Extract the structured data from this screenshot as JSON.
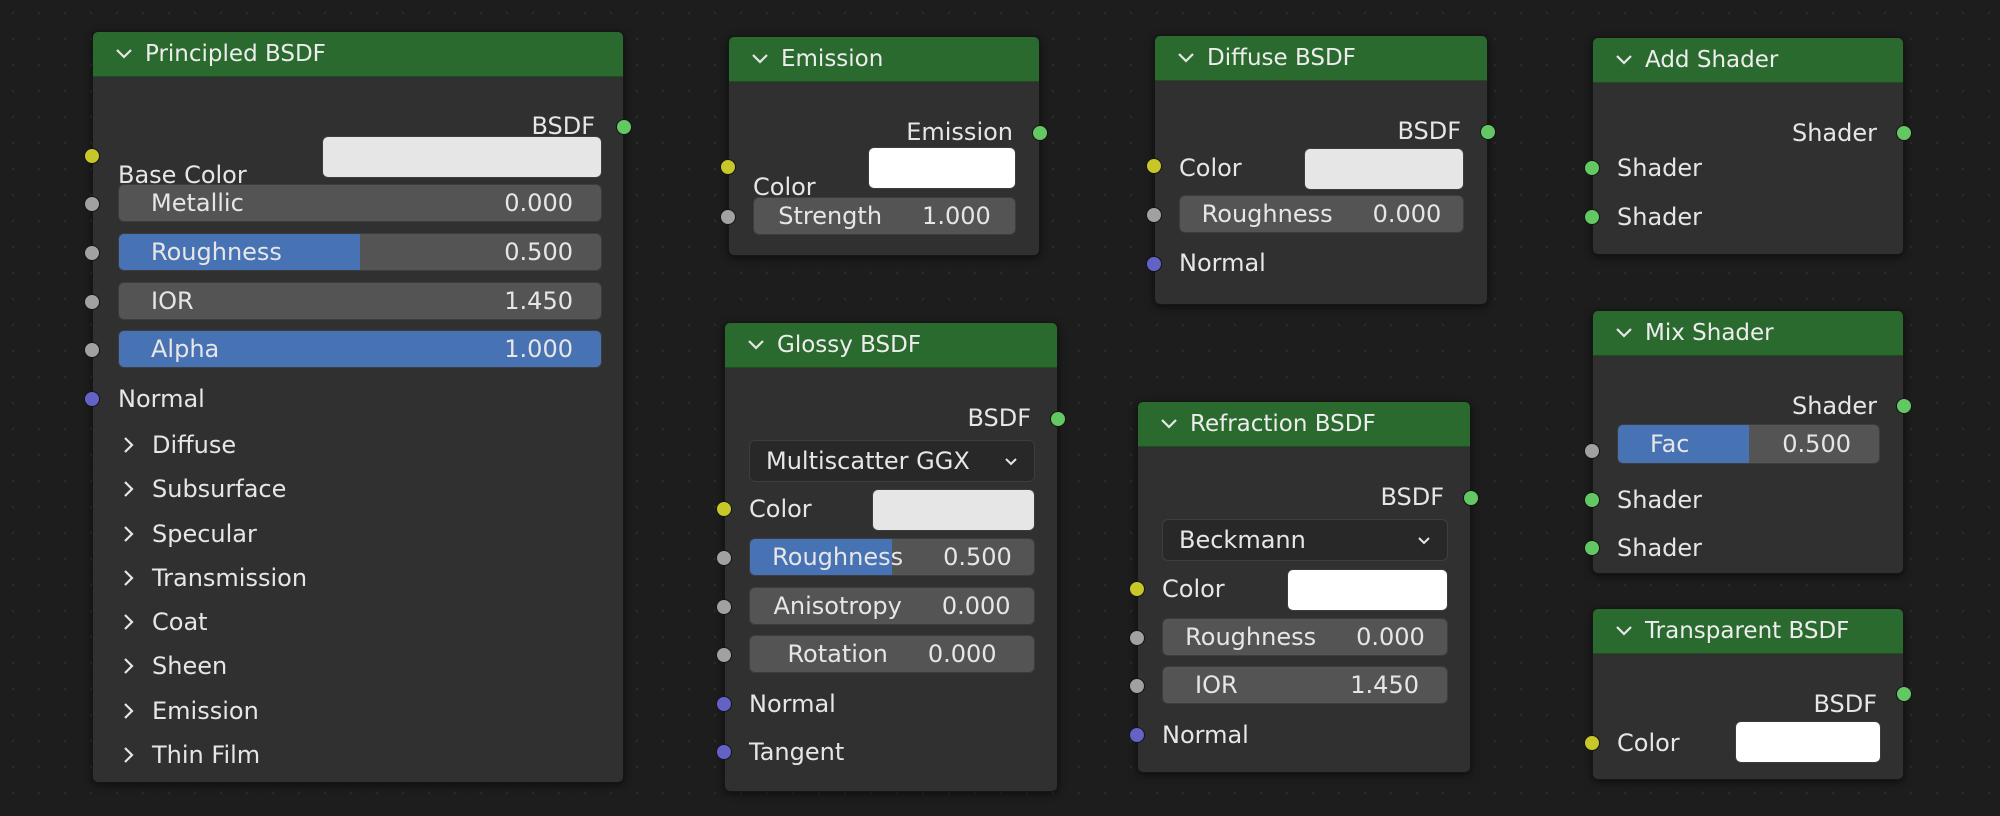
{
  "colors": {
    "header": "#2b6a2e",
    "socket_shader": "#63c763",
    "socket_color": "#c7c729",
    "socket_float": "#a1a1a1",
    "socket_vector": "#6363c7",
    "slider_fill": "#4772b3"
  },
  "principled": {
    "title": "Principled BSDF",
    "output": "BSDF",
    "base_color": "Base Color",
    "base_color_value": "#e6e6e6",
    "metallic": {
      "label": "Metallic",
      "value": "0.000",
      "fill": 0
    },
    "roughness": {
      "label": "Roughness",
      "value": "0.500",
      "fill": 0.5
    },
    "ior": {
      "label": "IOR",
      "value": "1.450",
      "fill": 0
    },
    "alpha": {
      "label": "Alpha",
      "value": "1.000",
      "fill": 1
    },
    "normal": "Normal",
    "panels": [
      "Diffuse",
      "Subsurface",
      "Specular",
      "Transmission",
      "Coat",
      "Sheen",
      "Emission",
      "Thin Film"
    ]
  },
  "emission": {
    "title": "Emission",
    "output": "Emission",
    "color": "Color",
    "color_value": "#ffffff",
    "strength": {
      "label": "Strength",
      "value": "1.000"
    }
  },
  "glossy": {
    "title": "Glossy BSDF",
    "output": "BSDF",
    "distribution": "Multiscatter GGX",
    "color": "Color",
    "color_value": "#e6e6e6",
    "roughness": {
      "label": "Roughness",
      "value": "0.500",
      "fill": 0.5
    },
    "anisotropy": {
      "label": "Anisotropy",
      "value": "0.000"
    },
    "rotation": {
      "label": "Rotation",
      "value": "0.000"
    },
    "normal": "Normal",
    "tangent": "Tangent"
  },
  "diffuse": {
    "title": "Diffuse BSDF",
    "output": "BSDF",
    "color": "Color",
    "color_value": "#e6e6e6",
    "roughness": {
      "label": "Roughness",
      "value": "0.000"
    },
    "normal": "Normal"
  },
  "refraction": {
    "title": "Refraction BSDF",
    "output": "BSDF",
    "distribution": "Beckmann",
    "color": "Color",
    "color_value": "#ffffff",
    "roughness": {
      "label": "Roughness",
      "value": "0.000"
    },
    "ior": {
      "label": "IOR",
      "value": "1.450"
    },
    "normal": "Normal"
  },
  "add_shader": {
    "title": "Add Shader",
    "output": "Shader",
    "input1": "Shader",
    "input2": "Shader"
  },
  "mix_shader": {
    "title": "Mix Shader",
    "output": "Shader",
    "fac": {
      "label": "Fac",
      "value": "0.500",
      "fill": 0.5
    },
    "input1": "Shader",
    "input2": "Shader"
  },
  "transparent": {
    "title": "Transparent BSDF",
    "output": "BSDF",
    "color": "Color",
    "color_value": "#ffffff"
  }
}
